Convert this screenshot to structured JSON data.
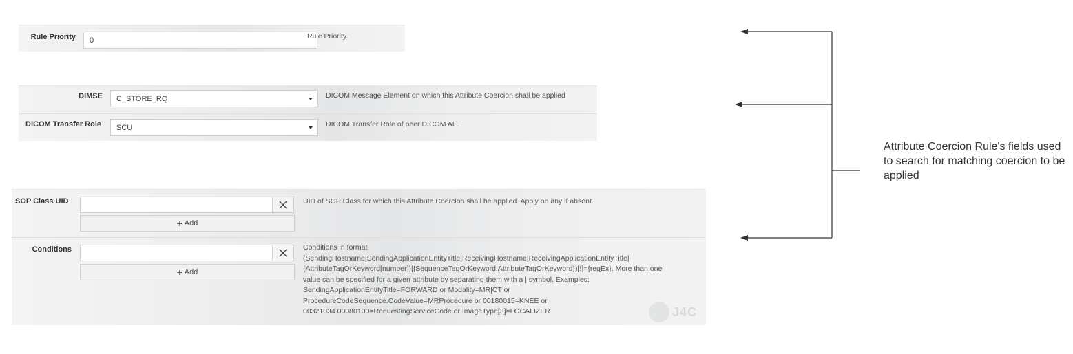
{
  "rule_priority": {
    "label": "Rule Priority",
    "value": "0",
    "help": "Rule Priority."
  },
  "dimse": {
    "label": "DIMSE",
    "value": "C_STORE_RQ",
    "help": "DICOM Message Element on which this Attribute Coercion shall be applied"
  },
  "transfer_role": {
    "label": "DICOM Transfer Role",
    "value": "SCU",
    "help": "DICOM Transfer Role of peer DICOM AE."
  },
  "sop_class_uid": {
    "label": "SOP Class UID",
    "value": "",
    "clear_icon": "close-icon",
    "add_label": "Add",
    "help": "UID of SOP Class for which this Attribute Coercion shall be applied. Apply on any if absent."
  },
  "conditions": {
    "label": "Conditions",
    "value": "",
    "clear_icon": "close-icon",
    "add_label": "Add",
    "help_lines": [
      "Conditions in format",
      "(SendingHostname|SendingApplicationEntityTitle|ReceivingHostname|ReceivingApplicationEntityTitle|",
      "{AttributeTagOrKeyword[number]}|{SequenceTagOrKeyword.AttributeTagOrKeyword})[!]={regEx}. More than one",
      "value can be specified for a given attribute by separating them with a | symbol. Examples:",
      "SendingApplicationEntityTitle=FORWARD or Modality=MR|CT or",
      "ProcedureCodeSequence.CodeValue=MRProcedure or 00180015=KNEE or",
      "00321034.00080100=RequestingServiceCode or ImageType[3]=LOCALIZER"
    ]
  },
  "watermark": "J4C",
  "annotation": {
    "text": "Attribute Coercion Rule's fields used to search for matching coercion to be applied"
  },
  "colors": {
    "arrow": "#333333",
    "panel": "#eeeeee"
  }
}
